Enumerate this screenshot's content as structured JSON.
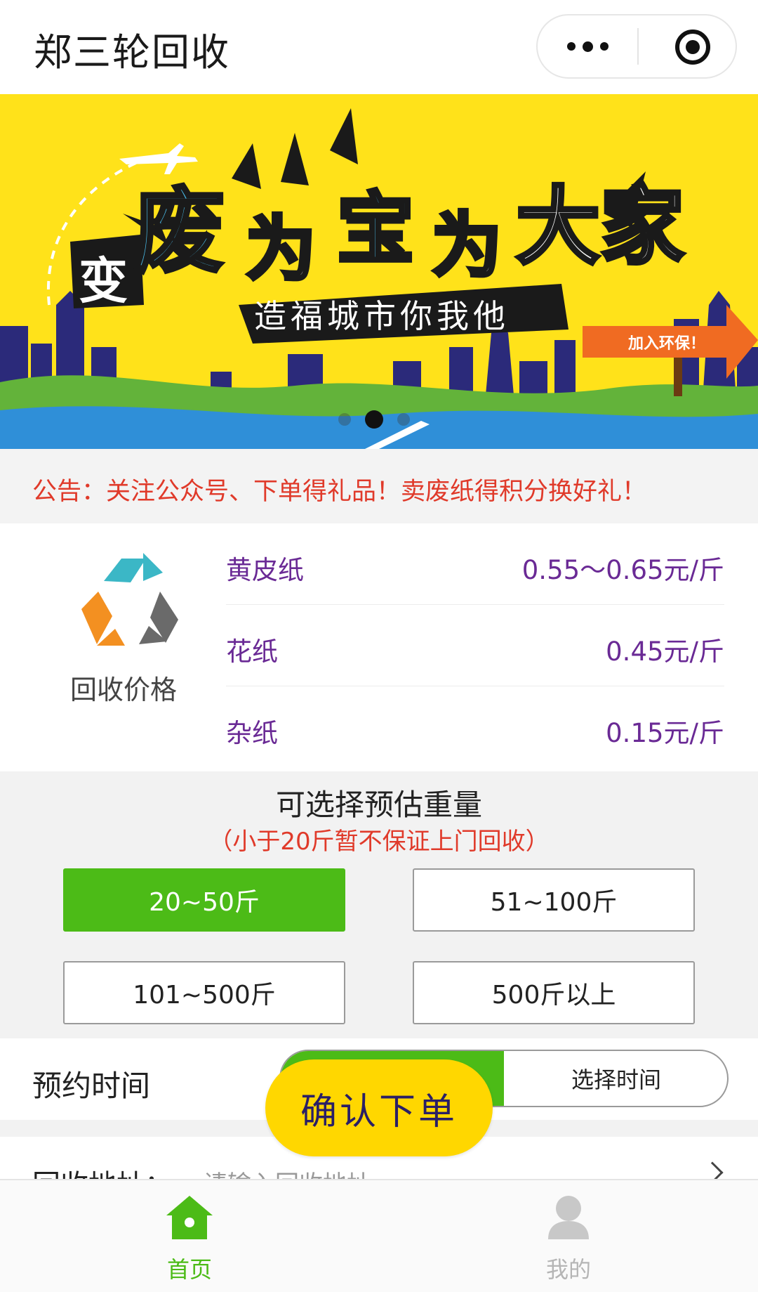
{
  "titlebar": {
    "title": "郑三轮回收",
    "more_icon": "more-dots-icon",
    "close_icon": "target-close-icon"
  },
  "banner": {
    "headline_prefix": "变",
    "headline_fei": "废",
    "headline_wei1": "为",
    "headline_bao": "宝",
    "headline_wei2": "为",
    "headline_dajia": "大家",
    "subline": "造福城市你我他",
    "arrow_text": "加入环保！",
    "carousel_total": 3,
    "carousel_active": 2
  },
  "notice": {
    "text": "公告：关注公众号、下单得礼品！卖废纸得积分换好礼！"
  },
  "prices": {
    "label": "回收价格",
    "icon": "recycle-icon",
    "items": [
      {
        "name": "黄皮纸",
        "value": "0.55～0.65元/斤"
      },
      {
        "name": "花纸",
        "value": "0.45元/斤"
      },
      {
        "name": "杂纸",
        "value": "0.15元/斤"
      }
    ]
  },
  "weight": {
    "title": "可选择预估重量",
    "note": "（小于20斤暂不保证上门回收）",
    "options": [
      {
        "label": "20~50斤",
        "selected": true
      },
      {
        "label": "51~100斤",
        "selected": false
      },
      {
        "label": "101~500斤",
        "selected": false
      },
      {
        "label": "500斤以上",
        "selected": false
      }
    ]
  },
  "appointment": {
    "label": "预约时间",
    "time_button": "选择时间"
  },
  "address": {
    "label": "回收地址：",
    "placeholder": "请输入回收地址"
  },
  "confirm_button": "确认下单",
  "tabbar": {
    "items": [
      {
        "label": "首页",
        "icon": "home-icon",
        "active": true
      },
      {
        "label": "我的",
        "icon": "user-icon",
        "active": false
      }
    ]
  },
  "colors": {
    "accent_green": "#4cbb17",
    "notice_red": "#e03a2a",
    "price_purple": "#6a2a95",
    "confirm_yellow": "#ffd700",
    "banner_yellow": "#ffe21a"
  }
}
